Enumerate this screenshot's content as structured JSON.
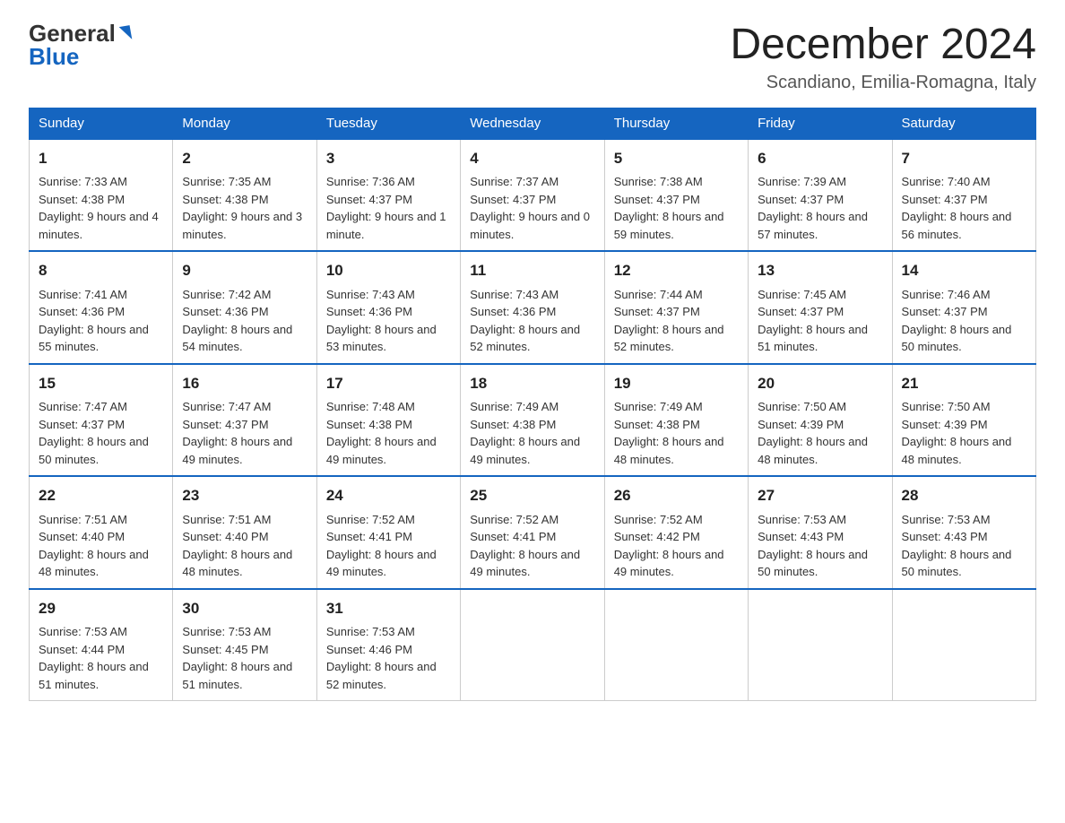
{
  "logo": {
    "general": "General",
    "blue": "Blue"
  },
  "title": "December 2024",
  "subtitle": "Scandiano, Emilia-Romagna, Italy",
  "days_of_week": [
    "Sunday",
    "Monday",
    "Tuesday",
    "Wednesday",
    "Thursday",
    "Friday",
    "Saturday"
  ],
  "weeks": [
    [
      {
        "num": "1",
        "sunrise": "7:33 AM",
        "sunset": "4:38 PM",
        "daylight": "9 hours and 4 minutes."
      },
      {
        "num": "2",
        "sunrise": "7:35 AM",
        "sunset": "4:38 PM",
        "daylight": "9 hours and 3 minutes."
      },
      {
        "num": "3",
        "sunrise": "7:36 AM",
        "sunset": "4:37 PM",
        "daylight": "9 hours and 1 minute."
      },
      {
        "num": "4",
        "sunrise": "7:37 AM",
        "sunset": "4:37 PM",
        "daylight": "9 hours and 0 minutes."
      },
      {
        "num": "5",
        "sunrise": "7:38 AM",
        "sunset": "4:37 PM",
        "daylight": "8 hours and 59 minutes."
      },
      {
        "num": "6",
        "sunrise": "7:39 AM",
        "sunset": "4:37 PM",
        "daylight": "8 hours and 57 minutes."
      },
      {
        "num": "7",
        "sunrise": "7:40 AM",
        "sunset": "4:37 PM",
        "daylight": "8 hours and 56 minutes."
      }
    ],
    [
      {
        "num": "8",
        "sunrise": "7:41 AM",
        "sunset": "4:36 PM",
        "daylight": "8 hours and 55 minutes."
      },
      {
        "num": "9",
        "sunrise": "7:42 AM",
        "sunset": "4:36 PM",
        "daylight": "8 hours and 54 minutes."
      },
      {
        "num": "10",
        "sunrise": "7:43 AM",
        "sunset": "4:36 PM",
        "daylight": "8 hours and 53 minutes."
      },
      {
        "num": "11",
        "sunrise": "7:43 AM",
        "sunset": "4:36 PM",
        "daylight": "8 hours and 52 minutes."
      },
      {
        "num": "12",
        "sunrise": "7:44 AM",
        "sunset": "4:37 PM",
        "daylight": "8 hours and 52 minutes."
      },
      {
        "num": "13",
        "sunrise": "7:45 AM",
        "sunset": "4:37 PM",
        "daylight": "8 hours and 51 minutes."
      },
      {
        "num": "14",
        "sunrise": "7:46 AM",
        "sunset": "4:37 PM",
        "daylight": "8 hours and 50 minutes."
      }
    ],
    [
      {
        "num": "15",
        "sunrise": "7:47 AM",
        "sunset": "4:37 PM",
        "daylight": "8 hours and 50 minutes."
      },
      {
        "num": "16",
        "sunrise": "7:47 AM",
        "sunset": "4:37 PM",
        "daylight": "8 hours and 49 minutes."
      },
      {
        "num": "17",
        "sunrise": "7:48 AM",
        "sunset": "4:38 PM",
        "daylight": "8 hours and 49 minutes."
      },
      {
        "num": "18",
        "sunrise": "7:49 AM",
        "sunset": "4:38 PM",
        "daylight": "8 hours and 49 minutes."
      },
      {
        "num": "19",
        "sunrise": "7:49 AM",
        "sunset": "4:38 PM",
        "daylight": "8 hours and 48 minutes."
      },
      {
        "num": "20",
        "sunrise": "7:50 AM",
        "sunset": "4:39 PM",
        "daylight": "8 hours and 48 minutes."
      },
      {
        "num": "21",
        "sunrise": "7:50 AM",
        "sunset": "4:39 PM",
        "daylight": "8 hours and 48 minutes."
      }
    ],
    [
      {
        "num": "22",
        "sunrise": "7:51 AM",
        "sunset": "4:40 PM",
        "daylight": "8 hours and 48 minutes."
      },
      {
        "num": "23",
        "sunrise": "7:51 AM",
        "sunset": "4:40 PM",
        "daylight": "8 hours and 48 minutes."
      },
      {
        "num": "24",
        "sunrise": "7:52 AM",
        "sunset": "4:41 PM",
        "daylight": "8 hours and 49 minutes."
      },
      {
        "num": "25",
        "sunrise": "7:52 AM",
        "sunset": "4:41 PM",
        "daylight": "8 hours and 49 minutes."
      },
      {
        "num": "26",
        "sunrise": "7:52 AM",
        "sunset": "4:42 PM",
        "daylight": "8 hours and 49 minutes."
      },
      {
        "num": "27",
        "sunrise": "7:53 AM",
        "sunset": "4:43 PM",
        "daylight": "8 hours and 50 minutes."
      },
      {
        "num": "28",
        "sunrise": "7:53 AM",
        "sunset": "4:43 PM",
        "daylight": "8 hours and 50 minutes."
      }
    ],
    [
      {
        "num": "29",
        "sunrise": "7:53 AM",
        "sunset": "4:44 PM",
        "daylight": "8 hours and 51 minutes."
      },
      {
        "num": "30",
        "sunrise": "7:53 AM",
        "sunset": "4:45 PM",
        "daylight": "8 hours and 51 minutes."
      },
      {
        "num": "31",
        "sunrise": "7:53 AM",
        "sunset": "4:46 PM",
        "daylight": "8 hours and 52 minutes."
      },
      null,
      null,
      null,
      null
    ]
  ],
  "labels": {
    "sunrise": "Sunrise:",
    "sunset": "Sunset:",
    "daylight": "Daylight:"
  }
}
